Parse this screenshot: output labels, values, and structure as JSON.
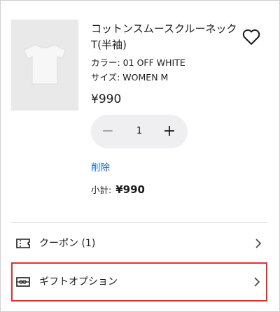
{
  "product": {
    "name": "コットンスムースクルーネックT(半袖)",
    "color": "カラー: 01 OFF WHITE",
    "size": "サイズ: WOMEN M",
    "price": "¥990",
    "quantity": "1",
    "delete_label": "削除",
    "subtotal_label": "小計:",
    "subtotal_value": "¥990",
    "icons": {
      "favorite": "heart-icon",
      "minus": "minus-icon",
      "plus": "plus-icon"
    }
  },
  "options": [
    {
      "label": "クーポン (1)",
      "icon": "ticket-icon"
    },
    {
      "label": "ギフトオプション",
      "icon": "gift-icon",
      "highlighted": true
    }
  ],
  "colors": {
    "link": "#1a66c2",
    "highlight_border": "#e03030",
    "stepper_bg": "#efeff1"
  }
}
